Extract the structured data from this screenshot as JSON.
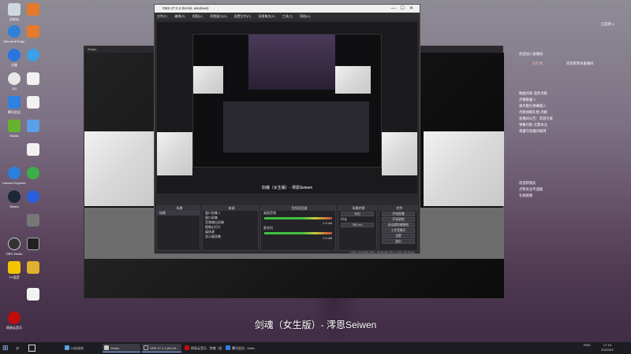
{
  "desktop": {
    "icons": [
      {
        "label": "回收站",
        "color": "#cfd8e0"
      },
      {
        "label": "Microsoft Edge",
        "color": "#2f80d6"
      },
      {
        "label": "迅雷",
        "color": "#2a75e0"
      },
      {
        "label": "QQ",
        "color": "#e8e8e8"
      },
      {
        "label": "腾讯会议",
        "color": "#2f80e0"
      },
      {
        "label": "Nvidia",
        "color": "#65b32e"
      },
      {
        "label": "Internet Explorer",
        "color": "#2b7fe0"
      },
      {
        "label": "Steam",
        "color": "#1c2838"
      },
      {
        "label": "OBS Studio",
        "color": "#333"
      },
      {
        "label": "YY语音",
        "color": "#f5c400"
      },
      {
        "label": "网易云音乐",
        "color": "#c20c0c"
      }
    ]
  },
  "projector": {
    "title": "Studio"
  },
  "obs": {
    "title": "OBS 27.2.4 (64-bit, windows)",
    "menu": [
      "文件(F)",
      "编辑(E)",
      "视图(V)",
      "停靠窗口(D)",
      "配置文件(P)",
      "场景集合(S)",
      "工具(T)",
      "帮助(H)"
    ],
    "lyric": "剑魂（女生版）- 澪恩Seiwen",
    "docks": {
      "scenes": {
        "header": "场景",
        "items": [
          "场景"
        ]
      },
      "sources": {
        "header": "来源",
        "items": [
          "窗口采集 2",
          "窗口采集",
          "音频输出采集",
          "图像幻灯片",
          "媒体源",
          "显示器采集"
        ]
      },
      "mixer": {
        "header": "音频混音器",
        "channels": [
          "桌面音频",
          "麦克风"
        ],
        "db": [
          "0.0 dB",
          "0.0 dB"
        ]
      },
      "transitions": {
        "header": "场景转换",
        "mode": "淡出",
        "duration_label": "时长",
        "duration": "300 ms"
      },
      "controls": {
        "header": "控件",
        "buttons": [
          "开始直播",
          "开始录制",
          "启动虚拟摄像机",
          "工作室模式",
          "设置",
          "退出"
        ]
      }
    },
    "status": [
      "LIVE: 00:00:00",
      "REC: 00:00:00",
      "CPU: 3.2%, 30.00 fps"
    ]
  },
  "chat": {
    "lines": [
      "已选择·1",
      "欢迎加入直播间",
      "送礼物",
      "欢迎来到本直播间",
      "歌曲列表·选择点歌",
      "点播歌曲·1",
      "请点歌在弹幕输入",
      "点歌请刷礼物·点歌",
      "直播间公告：欢迎大家",
      "弹幕点歌·无需关注",
      "请遵守直播间规则",
      "欢迎新朋友",
      "点赞关注不迷路",
      "礼物感谢"
    ]
  },
  "song_title": "剑魂（女生版）- 澪恩Seiwen",
  "taskbar": {
    "items": [
      "UI自动化",
      "Studio",
      "OBS 27.2.4 (64-bit...",
      "网易云音乐 - 剑魂（女生版...",
      "腾讯会议 - Multi..."
    ],
    "clock": "17:19",
    "date": "2022/3/4",
    "lang": "ENG"
  }
}
